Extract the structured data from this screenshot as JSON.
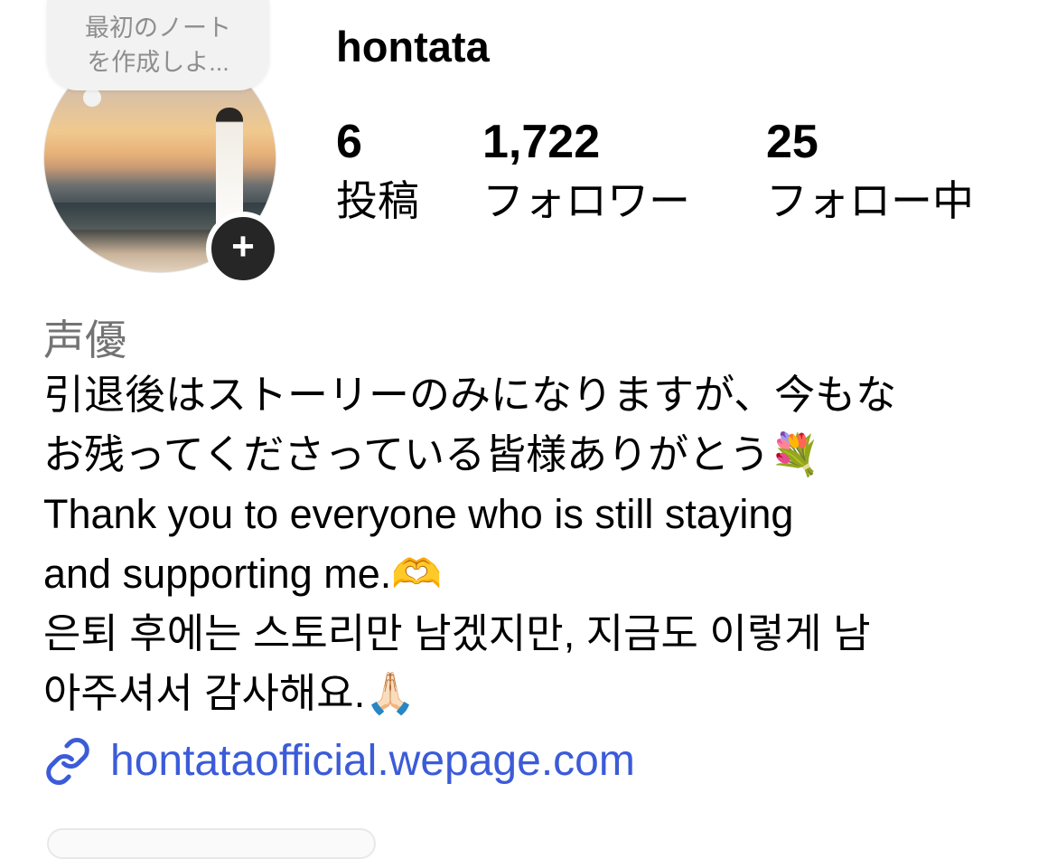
{
  "note": {
    "line1": "最初のノート",
    "line2": "を作成しよ..."
  },
  "profile": {
    "username": "hontata",
    "stats": [
      {
        "value": "6",
        "label": "投稿"
      },
      {
        "value": "1,722",
        "label": "フォロワー"
      },
      {
        "value": "25",
        "label": "フォロー中"
      }
    ],
    "category": "声優",
    "bio": [
      "引退後はストーリーのみになりますが、今もな",
      "お残ってくださっている皆様ありがとう💐",
      "Thank you to everyone who is still staying",
      "and supporting me.🫶",
      "은퇴 후에는 스토리만 남겠지만, 지금도 이렇게 남",
      "아주셔서 감사해요.🙏🏻"
    ],
    "link": "hontataofficial.wepage.com",
    "add_icon": "plus-icon",
    "link_icon": "link-icon"
  },
  "colors": {
    "link": "#3b5bd9",
    "category": "#737373",
    "add_button": "#262626"
  }
}
